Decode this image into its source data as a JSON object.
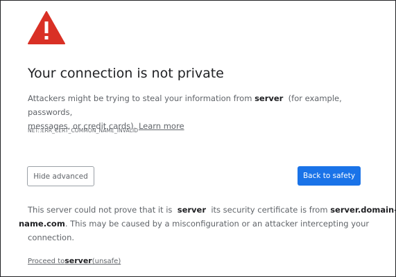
{
  "colors": {
    "warning_red": "#d93025",
    "primary_blue": "#1a73e8",
    "text_muted": "#5f6368",
    "text_dark": "#202124"
  },
  "icon": "warning-triangle",
  "title": "Your connection is not private",
  "description": {
    "part1": "Attackers might be trying to steal your information from",
    "host": "server",
    "part2": "(for example, passwords,",
    "part3": "messages, or credit cards).",
    "learn_more": "Learn more"
  },
  "error_code": "NET::ERR_CERT_COMMON_NAME_INVALID",
  "buttons": {
    "hide_advanced": "Hide advanced",
    "back_to_safety": "Back to safety"
  },
  "details": {
    "part1": "This server could not prove that it is",
    "server": "server",
    "part2": "its security certificate is from",
    "cert_domain_a": "server.domain-",
    "cert_domain_b": "name",
    "cert_domain_c": ".com",
    "part3": ". This may be caused by a misconfiguration or an attacker intercepting your",
    "part4": "connection."
  },
  "proceed": {
    "prefix": "Proceed to",
    "host": "server",
    "suffix": "(unsafe)"
  }
}
